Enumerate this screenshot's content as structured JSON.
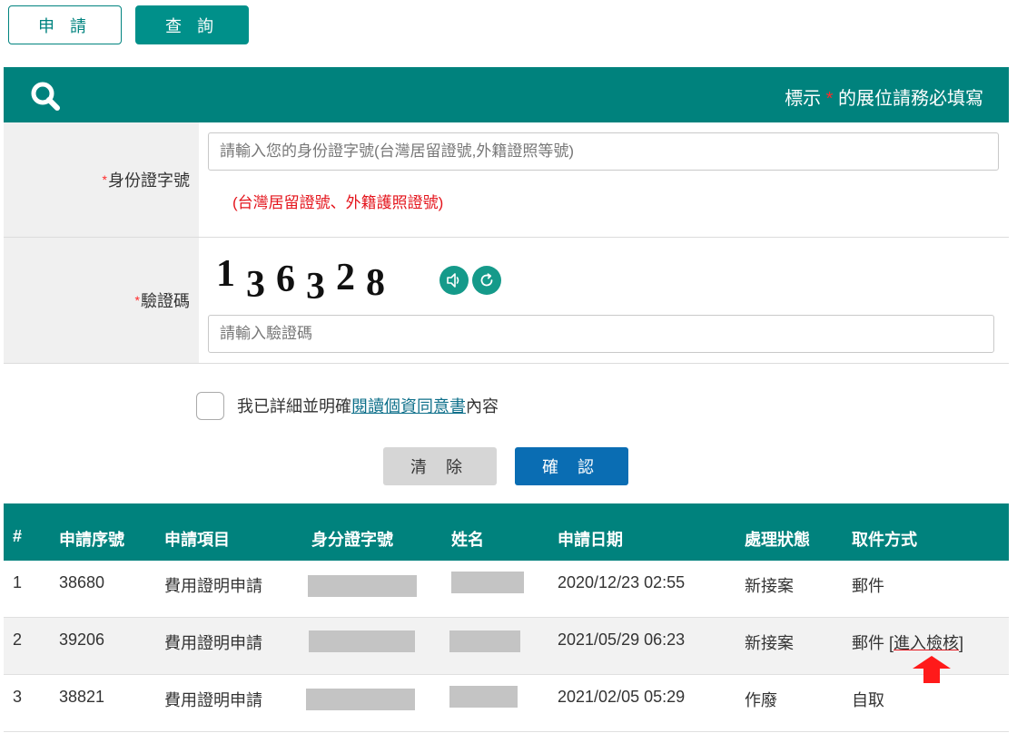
{
  "tabs": {
    "apply": "申 請",
    "query": "查 詢"
  },
  "panel": {
    "note_prefix": "標示",
    "note_star": "*",
    "note_suffix": "的展位請務必填寫"
  },
  "form": {
    "id_label": "身份證字號",
    "id_placeholder": "請輸入您的身份證字號(台灣居留證號,外籍證照等號)",
    "id_hint": "(台灣居留證號、外籍護照證號)",
    "captcha_label": "驗證碼",
    "captcha_digits": [
      "1",
      "3",
      "6",
      "3",
      "2",
      "8"
    ],
    "captcha_placeholder": "請輸入驗證碼",
    "required_mark": "*"
  },
  "agreement": {
    "prefix": "我已詳細並明確",
    "link": "閱讀個資同意書",
    "suffix": "內容"
  },
  "buttons": {
    "clear": "清 除",
    "confirm": "確 認"
  },
  "table": {
    "headers": [
      "#",
      "申請序號",
      "申請項目",
      "身分證字號",
      "姓名",
      "申請日期",
      "處理狀態",
      "取件方式"
    ],
    "rows": [
      {
        "num": "1",
        "serial": "38680",
        "item": "費用證明申請",
        "date": "2020/12/23 02:55",
        "status": "新接案",
        "pickup": "郵件"
      },
      {
        "num": "2",
        "serial": "39206",
        "item": "費用證明申請",
        "date": "2021/05/29 06:23",
        "status": "新接案",
        "pickup": "郵件",
        "action_open": "[",
        "action_link": "進入檢核",
        "action_close": "]"
      },
      {
        "num": "3",
        "serial": "38821",
        "item": "費用證明申請",
        "date": "2021/02/05 05:29",
        "status": "作廢",
        "pickup": "自取"
      }
    ]
  },
  "colors": {
    "teal": "#00827d",
    "blue": "#0a6db3",
    "red": "#e4141c"
  }
}
